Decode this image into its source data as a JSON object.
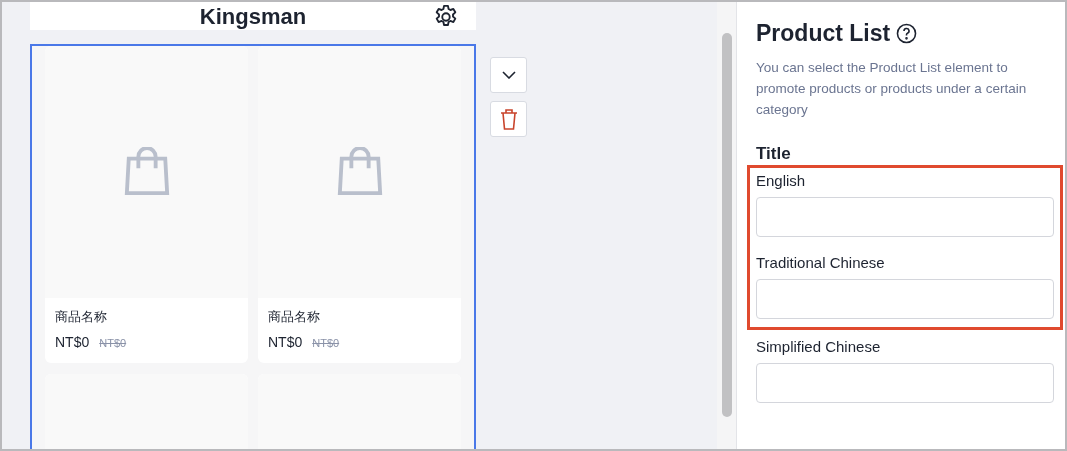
{
  "store_header": {
    "title": "Kingsman"
  },
  "products": [
    {
      "kind": "product",
      "name": "商品名称",
      "price": "NT$0",
      "original_price": "NT$0"
    },
    {
      "kind": "product",
      "name": "商品名称",
      "price": "NT$0",
      "original_price": "NT$0"
    },
    {
      "kind": "blank"
    },
    {
      "kind": "blank"
    }
  ],
  "block_selected": true,
  "panel": {
    "title": "Product List",
    "description": "You can select the Product List element to promote products or products under a certain category",
    "section": "Title",
    "fields": [
      {
        "label": "English",
        "highlighted": true
      },
      {
        "label": "Traditional Chinese",
        "highlighted": true
      },
      {
        "label": "Simplified Chinese",
        "highlighted": false
      }
    ]
  }
}
